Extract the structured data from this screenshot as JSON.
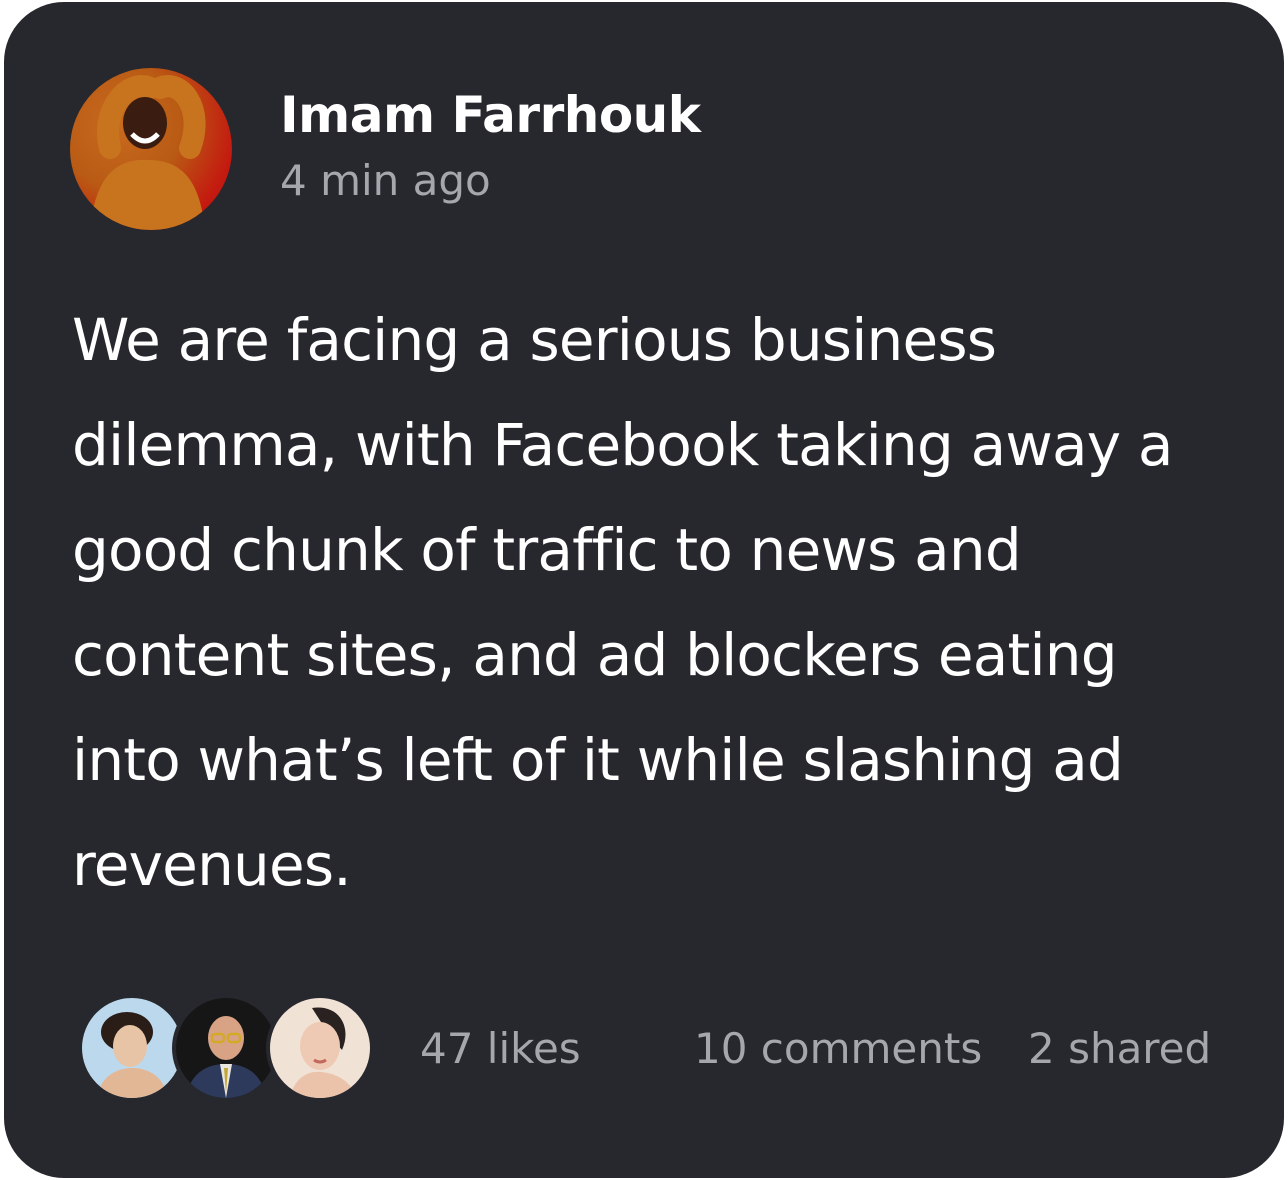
{
  "post": {
    "author": {
      "name": "Imam Farrhouk",
      "time": "4 min ago",
      "avatar_icon": "user-avatar"
    },
    "body": "We are facing a serious business dilemma, with Facebook taking away a good chunk of traffic to news and content sites, and ad blockers eating into what’s left of it while slashing ad revenues.",
    "reactions": {
      "avatars": [
        "reactor-avatar-1",
        "reactor-avatar-2",
        "reactor-avatar-3"
      ],
      "likes": "47 likes",
      "comments": "10 comments",
      "shared": "2 shared"
    }
  },
  "colors": {
    "card_background": "#27272e",
    "primary_text": "#ffffff",
    "secondary_text": "#a6a6ad"
  }
}
